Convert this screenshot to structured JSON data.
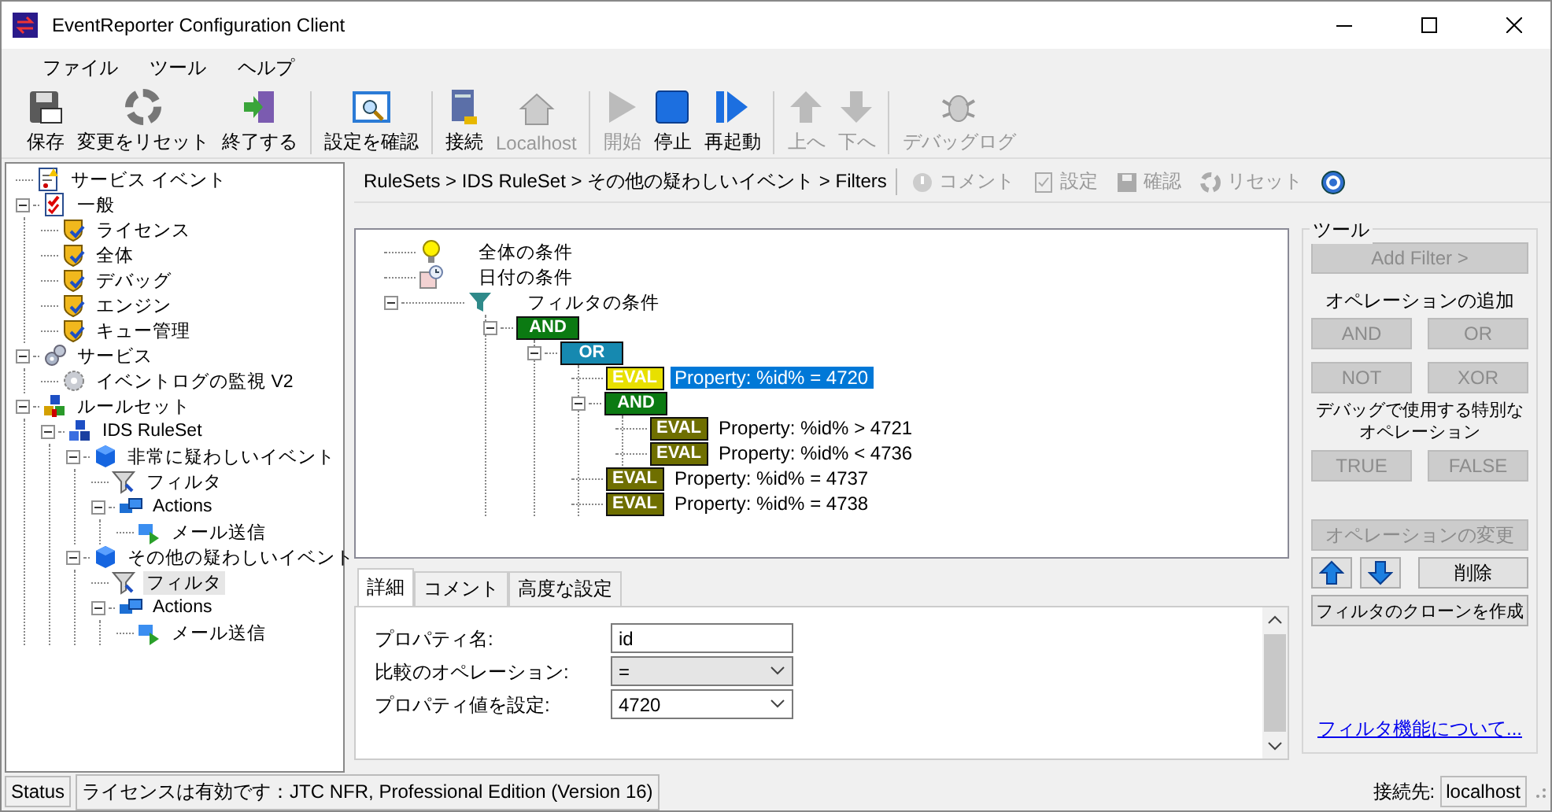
{
  "window": {
    "title": "EventReporter Configuration Client"
  },
  "menu": [
    "ファイル",
    "ツール",
    "ヘルプ"
  ],
  "toolbar": [
    [
      {
        "label": "保存",
        "disabled": false
      },
      {
        "label": "変更をリセット",
        "disabled": false
      },
      {
        "label": "終了する",
        "disabled": false
      }
    ],
    [
      {
        "label": "設定を確認",
        "disabled": false
      }
    ],
    [
      {
        "label": "接続",
        "disabled": false
      },
      {
        "label": "Localhost",
        "disabled": true
      }
    ],
    [
      {
        "label": "開始",
        "disabled": true
      },
      {
        "label": "停止",
        "disabled": false
      },
      {
        "label": "再起動",
        "disabled": false
      }
    ],
    [
      {
        "label": "上へ",
        "disabled": true
      },
      {
        "label": "下へ",
        "disabled": true
      }
    ],
    [
      {
        "label": "デバッグログ",
        "disabled": true
      }
    ]
  ],
  "nav_tree": [
    {
      "label": "サービス イベント",
      "kind": "event",
      "selected": false
    },
    {
      "label": "一般",
      "kind": "general",
      "expanded": true,
      "selected": false,
      "children": [
        {
          "label": "ライセンス",
          "kind": "setting",
          "selected": false
        },
        {
          "label": "全体",
          "kind": "setting",
          "selected": false
        },
        {
          "label": "デバッグ",
          "kind": "setting",
          "selected": false
        },
        {
          "label": "エンジン",
          "kind": "setting",
          "selected": false
        },
        {
          "label": "キュー管理",
          "kind": "setting",
          "selected": false
        }
      ]
    },
    {
      "label": "サービス",
      "kind": "service",
      "expanded": true,
      "selected": false,
      "children": [
        {
          "label": "イベントログの監視 V2",
          "kind": "monitor",
          "selected": false
        }
      ]
    },
    {
      "label": "ルールセット",
      "kind": "ruleset",
      "expanded": true,
      "selected": false,
      "children": [
        {
          "label": "IDS RuleSet",
          "kind": "ruleset-item",
          "expanded": true,
          "selected": false,
          "children": [
            {
              "label": "非常に疑わしいイベント",
              "kind": "rule",
              "expanded": true,
              "selected": false,
              "children": [
                {
                  "label": "フィルタ",
                  "kind": "filter",
                  "selected": false
                },
                {
                  "label": "Actions",
                  "kind": "actions",
                  "expanded": true,
                  "selected": false,
                  "children": [
                    {
                      "label": "メール送信",
                      "kind": "action",
                      "selected": false
                    }
                  ]
                }
              ]
            },
            {
              "label": "その他の疑わしいイベント",
              "kind": "rule",
              "expanded": true,
              "selected": false,
              "children": [
                {
                  "label": "フィルタ",
                  "kind": "filter",
                  "selected": true
                },
                {
                  "label": "Actions",
                  "kind": "actions",
                  "expanded": true,
                  "selected": false,
                  "children": [
                    {
                      "label": "メール送信",
                      "kind": "action",
                      "selected": false
                    }
                  ]
                }
              ]
            }
          ]
        }
      ]
    }
  ],
  "breadcrumb": "RuleSets > IDS RuleSet > その他の疑わしいイベント > Filters",
  "sub_toolbar": [
    {
      "label": "コメント",
      "disabled": true
    },
    {
      "label": "設定",
      "disabled": true
    },
    {
      "label": "確認",
      "disabled": true
    },
    {
      "label": "リセット",
      "disabled": true
    }
  ],
  "filter_tree": [
    {
      "kind": "general",
      "label": "全体の条件"
    },
    {
      "kind": "date",
      "label": "日付の条件"
    },
    {
      "kind": "filter",
      "label": "フィルタの条件",
      "expanded": true,
      "children": [
        {
          "kind": "operator",
          "label": "AND",
          "color": "#0b7a12",
          "expanded": true,
          "children": [
            {
              "kind": "operator",
              "label": "OR",
              "color": "#1689b0",
              "expanded": true,
              "children": [
                {
                  "kind": "eval",
                  "badge": "EVAL",
                  "label": "Property: %id% = 4720",
                  "selected": true
                },
                {
                  "kind": "operator",
                  "label": "AND",
                  "color": "#0b7a12",
                  "expanded": true,
                  "children": [
                    {
                      "kind": "eval",
                      "badge": "EVAL",
                      "label": "Property: %id% >  4721",
                      "selected": false
                    },
                    {
                      "kind": "eval",
                      "badge": "EVAL",
                      "label": "Property: %id% < 4736",
                      "selected": false
                    }
                  ]
                },
                {
                  "kind": "eval",
                  "badge": "EVAL",
                  "label": "Property: %id% = 4737",
                  "selected": false
                },
                {
                  "kind": "eval",
                  "badge": "EVAL",
                  "label": "Property: %id% = 4738",
                  "selected": false
                }
              ]
            }
          ]
        }
      ]
    }
  ],
  "detail_tabs": [
    {
      "label": "詳細",
      "selected": true
    },
    {
      "label": "コメント",
      "selected": false
    },
    {
      "label": "高度な設定",
      "selected": false
    }
  ],
  "fields": [
    {
      "label": "プロパティ名:",
      "kind": "text",
      "value": "id",
      "disabled": false
    },
    {
      "label": "比較のオペレーション:",
      "kind": "select",
      "value": "=",
      "disabled": true
    },
    {
      "label": "プロパティ値を設定:",
      "kind": "select",
      "value": "4720",
      "disabled": false
    }
  ],
  "tools": {
    "title": "ツール",
    "add_filter": {
      "label": "Add Filter >",
      "disabled": true
    },
    "add_operation_label": "オペレーションの追加",
    "operations": [
      {
        "label": "AND",
        "disabled": true
      },
      {
        "label": "OR",
        "disabled": true
      },
      {
        "label": "NOT",
        "disabled": true
      },
      {
        "label": "XOR",
        "disabled": true
      }
    ],
    "debug_label": [
      "デバッグで使用する特別な",
      "オペレーション"
    ],
    "debug_operations": [
      {
        "label": "TRUE",
        "disabled": true
      },
      {
        "label": "FALSE",
        "disabled": true
      }
    ],
    "change_operation": {
      "label": "オペレーションの変更",
      "disabled": true
    },
    "move_up": {
      "disabled": false
    },
    "move_down": {
      "disabled": false
    },
    "delete": {
      "label": "削除",
      "disabled": false
    },
    "clone": {
      "label": "フィルタのクローンを作成",
      "disabled": false
    },
    "link": "フィルタ機能について..."
  },
  "status_bar": {
    "label": "Status",
    "message": "ライセンスは有効です：JTC NFR, Professional Edition (Version 16)",
    "connection_label": "接続先:",
    "connection": "localhost"
  }
}
